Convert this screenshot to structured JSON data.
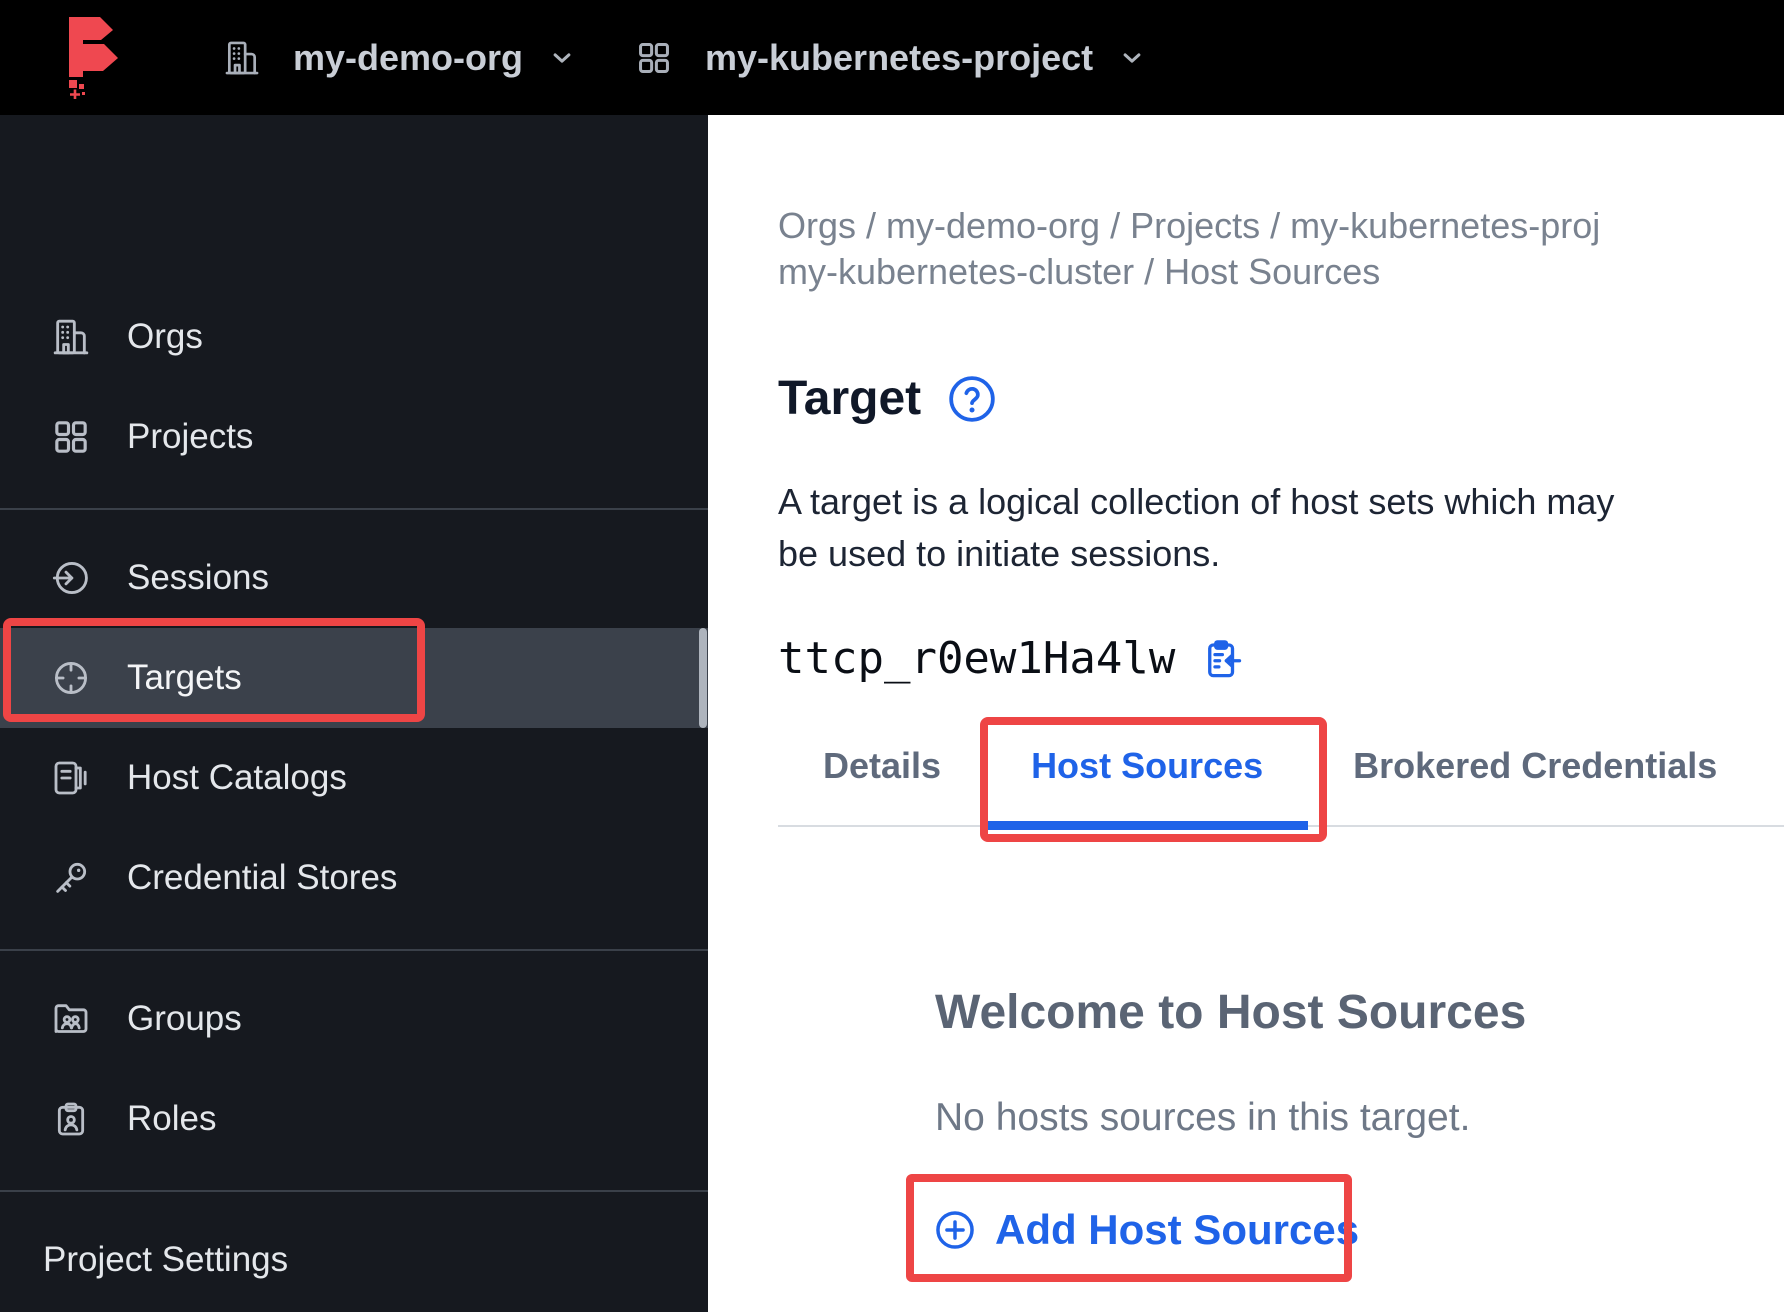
{
  "colors": {
    "accent_blue": "#1F63E8",
    "annotation_red": "#EE4545",
    "topbar_bg": "#000000",
    "sidebar_bg": "#16191F",
    "sidebar_active_bg": "#3B414B",
    "logo_red": "#EF4850"
  },
  "topbar": {
    "org_name": "my-demo-org",
    "project_name": "my-kubernetes-project"
  },
  "sidebar": {
    "sections": [
      {
        "items": [
          {
            "icon": "building-icon",
            "label": "Orgs"
          },
          {
            "icon": "grid-icon",
            "label": "Projects"
          }
        ]
      },
      {
        "items": [
          {
            "icon": "session-icon",
            "label": "Sessions"
          },
          {
            "icon": "target-icon",
            "label": "Targets",
            "active": true,
            "annotated": true
          },
          {
            "icon": "host-catalog-icon",
            "label": "Host Catalogs"
          },
          {
            "icon": "key-icon",
            "label": "Credential Stores"
          }
        ]
      },
      {
        "items": [
          {
            "icon": "groups-icon",
            "label": "Groups"
          },
          {
            "icon": "roles-icon",
            "label": "Roles"
          }
        ]
      }
    ],
    "footer_label": "Project Settings"
  },
  "main": {
    "breadcrumb_line1": "Orgs / my-demo-org / Projects / my-kubernetes-proj",
    "breadcrumb_line2": "my-kubernetes-cluster / Host Sources",
    "title": "Target",
    "description": "A target is a logical collection of host sets which may be used to initiate sessions.",
    "target_id": "ttcp_r0ew1Ha4lw",
    "tabs": [
      {
        "label": "Details",
        "active": false
      },
      {
        "label": "Host Sources",
        "active": true,
        "annotated": true
      },
      {
        "label": "Brokered Credentials",
        "active": false
      }
    ],
    "empty_state": {
      "title": "Welcome to Host Sources",
      "body": "No hosts sources in this target.",
      "action_label": "Add Host Sources",
      "annotated": true
    }
  }
}
